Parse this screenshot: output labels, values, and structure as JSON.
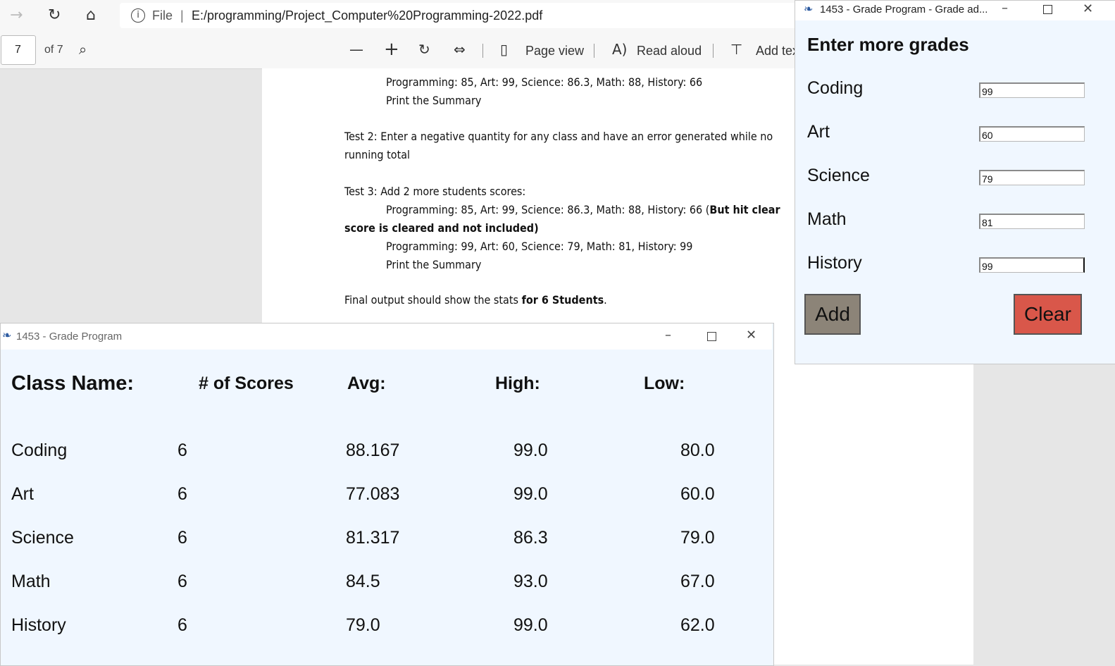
{
  "browser": {
    "file_label": "File",
    "url": "E:/programming/Project_Computer%20Programming-2022.pdf",
    "page_number": "7",
    "page_total": "of 7",
    "page_view_label": "Page view",
    "read_aloud_label": "Read aloud",
    "add_text_label": "Add tex"
  },
  "pdf": {
    "line1": "Programming: 85, Art: 99, Science: 86.3, Math: 88, History: 66",
    "line2": "Print the Summary",
    "line3": "Test 2: Enter a negative quantity for any class and have an error generated while no",
    "line4": "running total",
    "line5": "Test 3: Add 2 more students scores:",
    "line6a": "Programming: 85, Art: 99, Science: 86.3, Math: 88, History: 66 (",
    "line6b": "But hit clear",
    "line7": "score is cleared and not included)",
    "line8": "Programming: 99, Art: 60, Science: 79, Math: 81, History: 99",
    "line9": "Print the Summary",
    "line10a": "Final output should show the stats ",
    "line10b": "for 6 Students",
    "line10c": "."
  },
  "grade_window": {
    "title": "1453 - Grade Program",
    "headers": [
      "Class Name:",
      "# of Scores",
      "Avg:",
      "High:",
      "Low:"
    ],
    "rows": [
      {
        "name": "Coding",
        "count": "6",
        "avg": "88.167",
        "high": "99.0",
        "low": "80.0"
      },
      {
        "name": "Art",
        "count": "6",
        "avg": "77.083",
        "high": "99.0",
        "low": "60.0"
      },
      {
        "name": "Science",
        "count": "6",
        "avg": "81.317",
        "high": "86.3",
        "low": "79.0"
      },
      {
        "name": "Math",
        "count": "6",
        "avg": "84.5",
        "high": "93.0",
        "low": "67.0"
      },
      {
        "name": "History",
        "count": "6",
        "avg": "79.0",
        "high": "99.0",
        "low": "62.0"
      }
    ]
  },
  "add_window": {
    "title": "1453 - Grade Program - Grade ad...",
    "heading": "Enter more grades",
    "fields": [
      {
        "label": "Coding",
        "value": "99"
      },
      {
        "label": "Art",
        "value": "60"
      },
      {
        "label": "Science",
        "value": "79"
      },
      {
        "label": "Math",
        "value": "81"
      },
      {
        "label": "History",
        "value": "99"
      }
    ],
    "add_label": "Add",
    "clear_label": "Clear",
    "add_color": "#8c8478",
    "clear_color": "#d9574a"
  }
}
